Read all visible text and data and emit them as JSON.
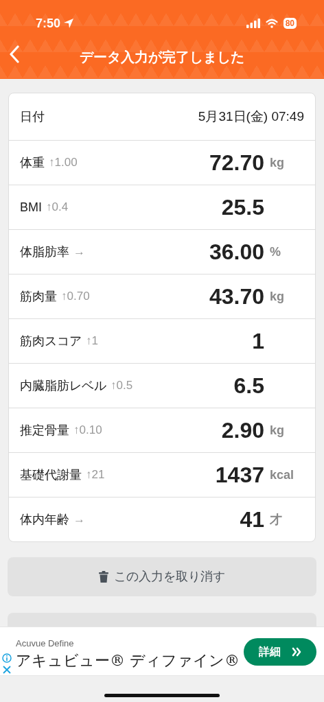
{
  "status_bar": {
    "time": "7:50",
    "battery": "80"
  },
  "header": {
    "title": "データ入力が完了しました"
  },
  "date_row": {
    "label": "日付",
    "value": "5月31日(金) 07:49"
  },
  "measurements": [
    {
      "label": "体重",
      "trend": "↑1.00",
      "value": "72.70",
      "unit": "kg"
    },
    {
      "label": "BMI",
      "trend": "↑0.4",
      "value": "25.5"
    },
    {
      "label": "体脂肪率",
      "trend": "→",
      "value": "36.00",
      "unit": "%"
    },
    {
      "label": "筋肉量",
      "trend": "↑0.70",
      "value": "43.70",
      "unit": "kg"
    },
    {
      "label": "筋肉スコア",
      "trend": "↑1",
      "value": "1"
    },
    {
      "label": "内臓脂肪レベル",
      "trend": "↑0.5",
      "value": "6.5"
    },
    {
      "label": "推定骨量",
      "trend": "↑0.10",
      "value": "2.90",
      "unit": "kg"
    },
    {
      "label": "基礎代謝量",
      "trend": "↑21",
      "value": "1437",
      "unit": "kcal"
    },
    {
      "label": "体内年齢",
      "trend": "→",
      "value": "41",
      "unit": "才"
    }
  ],
  "undo_button": {
    "label": "この入力を取り消す"
  },
  "ad": {
    "advertiser": "Acuvue Define",
    "headline": "アキュビュー® ディファイン®",
    "button": "詳細"
  }
}
